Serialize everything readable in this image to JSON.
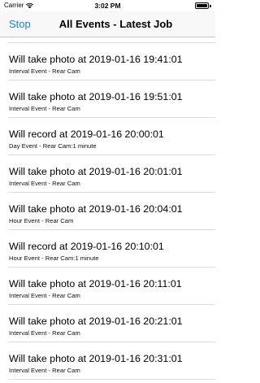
{
  "status_bar": {
    "carrier": "Carrier",
    "time": "3:02 PM"
  },
  "nav_bar": {
    "back_label": "Stop",
    "title": "All Events - Latest Job",
    "accent_color": "#147efb"
  },
  "events": [
    {
      "title": "Will take photo at 2019-01-16 19:41:01",
      "subtitle": "Interval Event  -  Rear Cam"
    },
    {
      "title": "Will take photo at 2019-01-16 19:51:01",
      "subtitle": "Interval Event  -  Rear Cam"
    },
    {
      "title": "Will record at 2019-01-16 20:00:01",
      "subtitle": "Day Event  -  Rear Cam:1 minute"
    },
    {
      "title": "Will take photo at 2019-01-16 20:01:01",
      "subtitle": "Interval Event  -  Rear Cam"
    },
    {
      "title": "Will take photo at 2019-01-16 20:04:01",
      "subtitle": "Hour Event  -  Rear Cam"
    },
    {
      "title": "Will record at 2019-01-16 20:10:01",
      "subtitle": "Hour Event  -  Rear Cam:1 minute"
    },
    {
      "title": "Will take photo at 2019-01-16 20:11:01",
      "subtitle": "Interval Event  -  Rear Cam"
    },
    {
      "title": "Will take photo at 2019-01-16 20:21:01",
      "subtitle": "Interval Event  -  Rear Cam"
    },
    {
      "title": "Will take photo at 2019-01-16 20:31:01",
      "subtitle": "Interval Event  -  Rear Cam"
    }
  ]
}
